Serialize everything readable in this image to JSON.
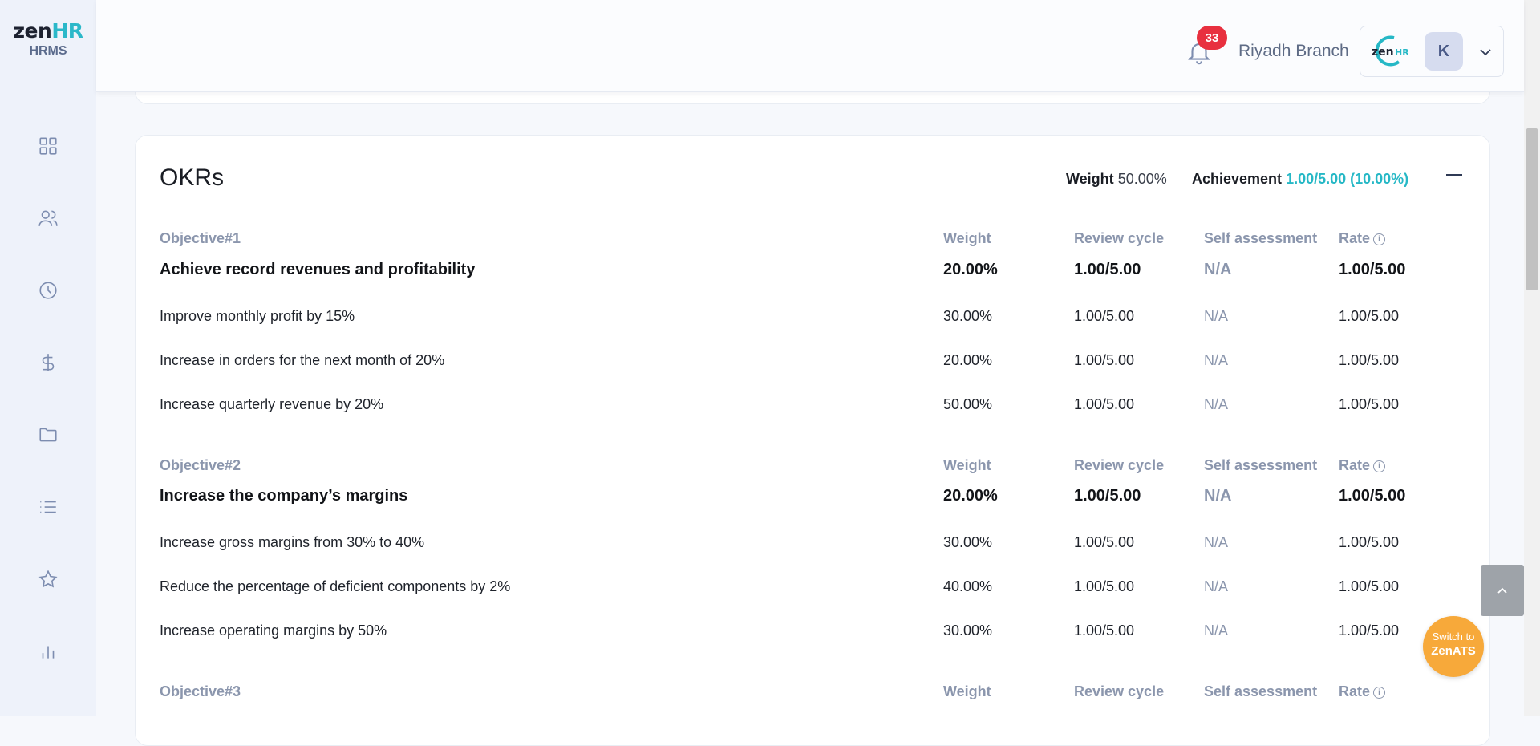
{
  "sidebar": {
    "brand_main": "zen",
    "brand_accent": "HR",
    "brand_sub": "HRMS",
    "icons": [
      "dashboard-icon",
      "people-icon",
      "clock-icon",
      "dollar-icon",
      "folder-icon",
      "list-icon",
      "star-icon",
      "chart-icon"
    ]
  },
  "header": {
    "notification_count": "33",
    "branch": "Riyadh Branch",
    "avatar_initial": "K"
  },
  "okrs": {
    "title": "OKRs",
    "weight_label": "Weight",
    "weight_value": "50.00%",
    "achievement_label": "Achievement",
    "achievement_value": "1.00/5.00 (10.00%)",
    "headers": {
      "weight": "Weight",
      "review_cycle": "Review cycle",
      "self_assessment": "Self assessment",
      "rate": "Rate"
    },
    "objectives": [
      {
        "label": "Objective#1",
        "title": "Achieve record revenues and profitability",
        "weight": "20.00%",
        "review_cycle": "1.00/5.00",
        "self_assessment": "N/A",
        "rate": "1.00/5.00",
        "key_results": [
          {
            "name": "Improve monthly profit by 15%",
            "weight": "30.00%",
            "review_cycle": "1.00/5.00",
            "self_assessment": "N/A",
            "rate": "1.00/5.00"
          },
          {
            "name": "Increase in orders for the next month of 20%",
            "weight": "20.00%",
            "review_cycle": "1.00/5.00",
            "self_assessment": "N/A",
            "rate": "1.00/5.00"
          },
          {
            "name": "Increase quarterly revenue by 20%",
            "weight": "50.00%",
            "review_cycle": "1.00/5.00",
            "self_assessment": "N/A",
            "rate": "1.00/5.00"
          }
        ]
      },
      {
        "label": "Objective#2",
        "title": "Increase the company’s margins",
        "weight": "20.00%",
        "review_cycle": "1.00/5.00",
        "self_assessment": "N/A",
        "rate": "1.00/5.00",
        "key_results": [
          {
            "name": "Increase gross margins from 30% to 40%",
            "weight": "30.00%",
            "review_cycle": "1.00/5.00",
            "self_assessment": "N/A",
            "rate": "1.00/5.00"
          },
          {
            "name": "Reduce the percentage of deficient components by 2%",
            "weight": "40.00%",
            "review_cycle": "1.00/5.00",
            "self_assessment": "N/A",
            "rate": "1.00/5.00"
          },
          {
            "name": "Increase operating margins by 50%",
            "weight": "30.00%",
            "review_cycle": "1.00/5.00",
            "self_assessment": "N/A",
            "rate": "1.00/5.00"
          }
        ]
      },
      {
        "label": "Objective#3",
        "title": "",
        "weight": "",
        "review_cycle": "",
        "self_assessment": "",
        "rate": "",
        "key_results": []
      }
    ]
  },
  "floating": {
    "switch_line1": "Switch to",
    "switch_line2": "ZenATS"
  },
  "colors": {
    "accent_teal": "#26b8c6",
    "badge_red": "#e8303f",
    "ats_orange": "#f7a93a"
  }
}
